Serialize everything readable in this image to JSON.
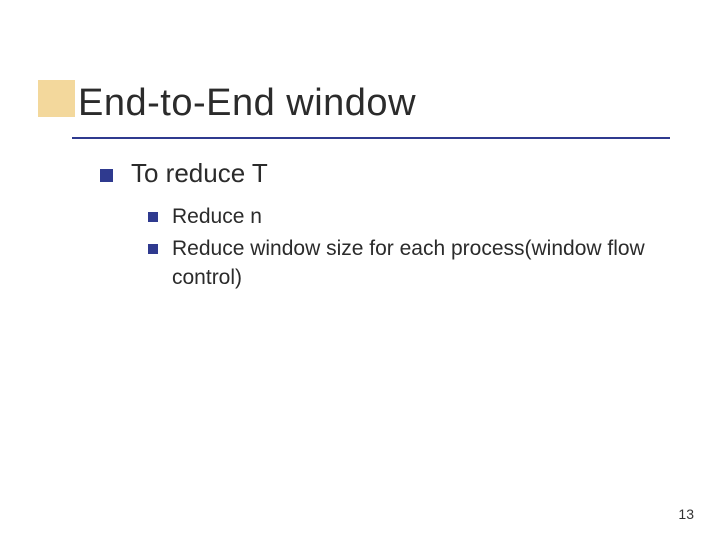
{
  "title": "End-to-End window",
  "bullets": {
    "lvl1": {
      "text": "To reduce T"
    },
    "lvl2": [
      {
        "text": "Reduce n"
      },
      {
        "text": "Reduce window size for each process(window flow control)"
      }
    ]
  },
  "page_number": "13"
}
